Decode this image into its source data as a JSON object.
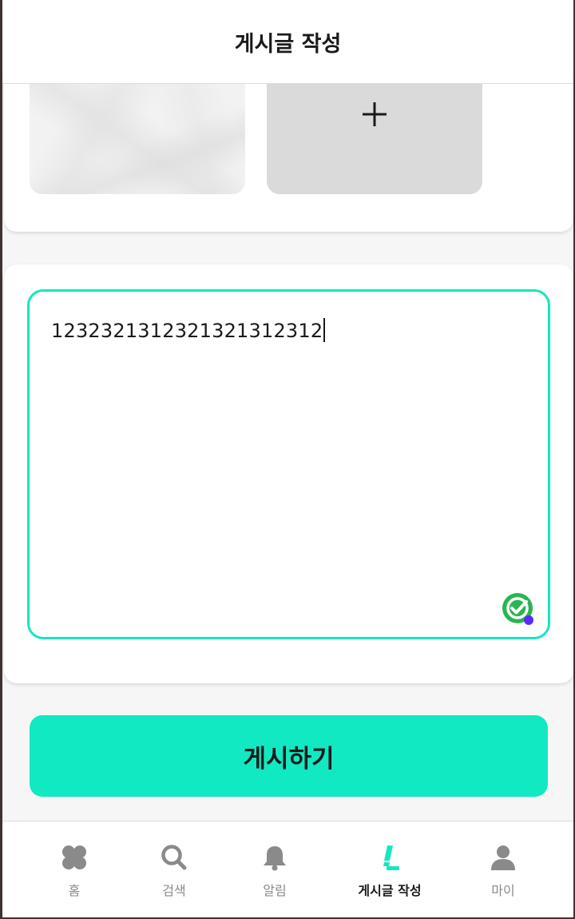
{
  "header": {
    "title": "게시글 작성"
  },
  "images": {
    "thumbnail_alt": "uploaded-photo",
    "add_icon": "plus-icon"
  },
  "editor": {
    "value": "12323213123213213123​12",
    "badge_icon": "grammar-check-icon",
    "border_color": "#19e5c0"
  },
  "submit": {
    "label": "게시하기",
    "color": "#11e9c2"
  },
  "nav": {
    "items": [
      {
        "label": "홈",
        "icon": "clover-icon",
        "active": false
      },
      {
        "label": "검색",
        "icon": "search-icon",
        "active": false
      },
      {
        "label": "알림",
        "icon": "bell-icon",
        "active": false
      },
      {
        "label": "게시글 작성",
        "icon": "pencil-icon",
        "active": true
      },
      {
        "label": "마이",
        "icon": "person-icon",
        "active": false
      }
    ],
    "active_color": "#19e5c0",
    "inactive_color": "#8a8a8a"
  }
}
